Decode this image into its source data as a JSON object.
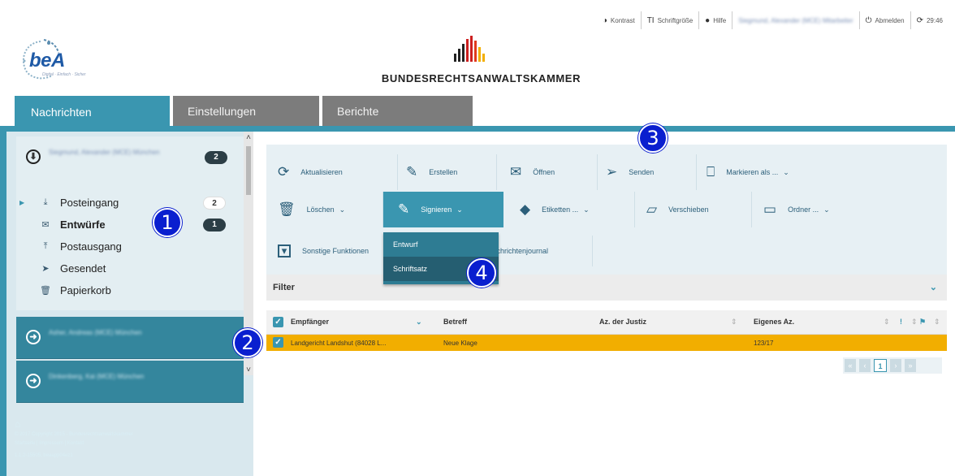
{
  "topnav": [
    {
      "icon": "contrast-icon",
      "glyph": "◑",
      "label": "Kontrast"
    },
    {
      "icon": "font-size-icon",
      "glyph": "TI",
      "label": "Schriftgröße"
    },
    {
      "icon": "help-icon",
      "glyph": "❓",
      "label": "Hilfe"
    },
    {
      "icon": "user-icon",
      "glyph": "",
      "label": "Siegmund, Alexander (MCE) Mitarbeiter"
    },
    {
      "icon": "power-icon",
      "glyph": "⏻",
      "label": "Abmelden"
    },
    {
      "icon": "refresh-icon",
      "glyph": "⟳",
      "label": "29:46"
    }
  ],
  "logos": {
    "bea": "beA",
    "bea_sub": "Digital · Einfach · Sicher",
    "brak": "BUNDESRECHTSANWALTSKAMMER"
  },
  "tabs": [
    "Nachrichten",
    "Einstellungen",
    "Berichte"
  ],
  "sidebar": {
    "active_account": {
      "name": "Siegmund, Alexander (MCE) München",
      "badge": "2"
    },
    "folders": [
      {
        "icon": "inbox-icon",
        "glyph": "⤓",
        "label": "Posteingang",
        "badge": "2"
      },
      {
        "icon": "drafts-icon",
        "glyph": "✉",
        "label": "Entwürfe",
        "badge": "1"
      },
      {
        "icon": "outbox-icon",
        "glyph": "⤒",
        "label": "Postausgang",
        "badge": ""
      },
      {
        "icon": "sent-icon",
        "glyph": "➤",
        "label": "Gesendet",
        "badge": ""
      },
      {
        "icon": "trash-icon",
        "glyph": "🗑",
        "label": "Papierkorb",
        "badge": ""
      }
    ],
    "other_accounts": [
      {
        "name": "Asher, Andreas (MCE) München"
      },
      {
        "name": "Dinkenberg, Kai (MCE) München"
      }
    ],
    "footer": {
      "copyright": "© 2017 Copyright 2015 - Bundesrechtsanwaltskammer",
      "links": "Startseite | Impressum | Kontakt",
      "version": "1.1.2-15505, beaapp04ez1"
    }
  },
  "toolbar": {
    "row1": [
      {
        "icon": "refresh-icon",
        "glyph": "⟳",
        "label": "Aktualisieren"
      },
      {
        "icon": "pencil-icon",
        "glyph": "✎",
        "label": "Erstellen"
      },
      {
        "icon": "envelope-icon",
        "glyph": "✉",
        "label": "Öffnen"
      },
      {
        "icon": "paper-plane-icon",
        "glyph": "➢",
        "label": "Senden"
      },
      {
        "icon": "bookmark-icon",
        "glyph": "⎕",
        "label": "Markieren als ..."
      }
    ],
    "row2": [
      {
        "icon": "trash-icon",
        "glyph": "🗑",
        "label": "Löschen"
      },
      {
        "icon": "sign-icon",
        "glyph": "✎",
        "label": "Signieren"
      },
      {
        "icon": "tag-icon",
        "glyph": "◆",
        "label": "Etiketten ..."
      },
      {
        "icon": "folder-open-icon",
        "glyph": "▱",
        "label": "Verschieben"
      },
      {
        "icon": "folder-icon",
        "glyph": "▭",
        "label": "Ordner ..."
      }
    ],
    "row3": [
      {
        "icon": "caret-box-icon",
        "glyph": "▾",
        "label": "Sonstige Funktionen"
      },
      {
        "icon": "",
        "glyph": "",
        "label": "Nachrichtenjournal"
      }
    ],
    "signieren_menu": [
      "Entwurf",
      "Schriftsatz"
    ]
  },
  "filter": {
    "label": "Filter"
  },
  "table": {
    "headers": [
      "Empfänger",
      "Betreff",
      "Az. der Justiz",
      "Eigenes Az."
    ],
    "rows": [
      {
        "recipient": "Landgericht Landshut (84028 L...",
        "subject": "Neue Klage",
        "court_ref": "",
        "own_ref": "123/17"
      }
    ]
  },
  "pager": {
    "page": "1"
  },
  "annotations": [
    "1",
    "2",
    "3",
    "4"
  ],
  "colors": {
    "accent": "#3a96b0",
    "highlight_row": "#f2ae00",
    "annotation": "#0a1fcf",
    "tab_inactive": "#7c7c7c"
  }
}
